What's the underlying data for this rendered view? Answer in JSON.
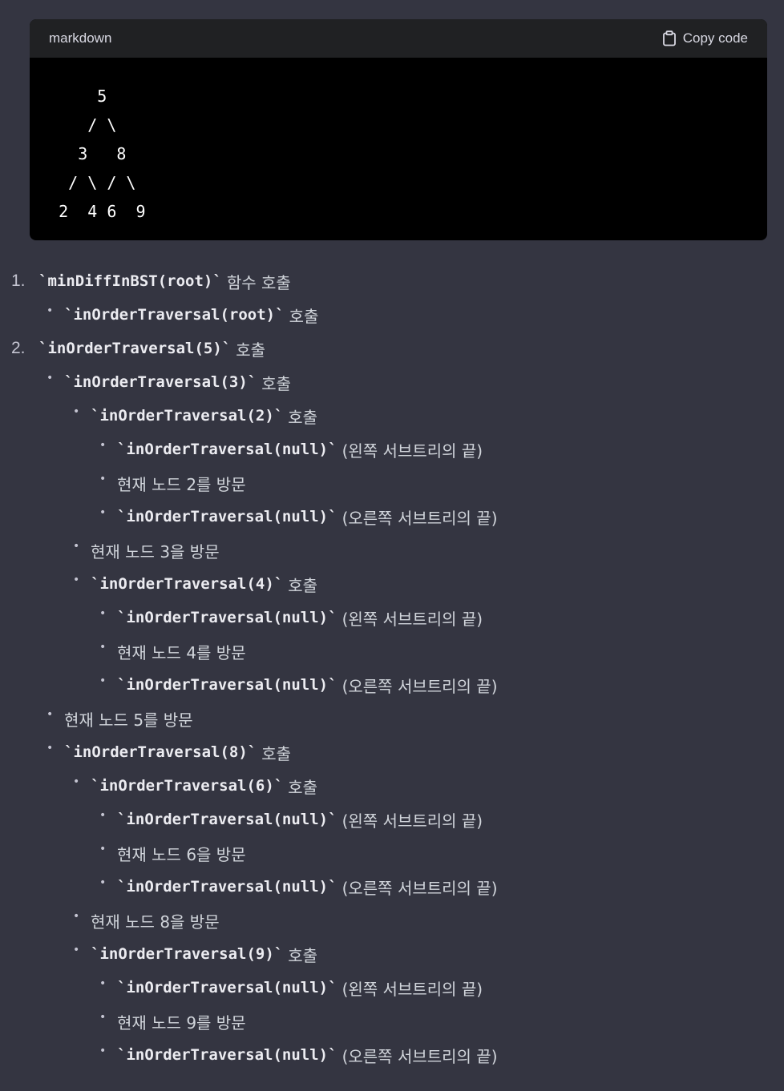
{
  "code_block": {
    "language": "markdown",
    "copy_label": "Copy code",
    "code": "       5\n      / \\\n     3   8\n    / \\ / \\\n   2  4 6  9"
  },
  "items": [
    {
      "marker": "1.",
      "code": "minDiffInBST(root)",
      "text": "함수 호출"
    },
    {
      "marker": "•",
      "code": "inOrderTraversal(root)",
      "text": "호출"
    },
    {
      "marker": "2.",
      "code": "inOrderTraversal(5)",
      "text": "호출"
    },
    {
      "marker": "•",
      "code": "inOrderTraversal(3)",
      "text": "호출"
    },
    {
      "marker": "•",
      "code": "inOrderTraversal(2)",
      "text": "호출"
    },
    {
      "marker": "•",
      "code": "inOrderTraversal(null)",
      "text": "(왼쪽 서브트리의 끝)"
    },
    {
      "marker": "•",
      "code": "",
      "text": "현재 노드 2를 방문"
    },
    {
      "marker": "•",
      "code": "inOrderTraversal(null)",
      "text": "(오른쪽 서브트리의 끝)"
    },
    {
      "marker": "•",
      "code": "",
      "text": "현재 노드 3을 방문"
    },
    {
      "marker": "•",
      "code": "inOrderTraversal(4)",
      "text": "호출"
    },
    {
      "marker": "•",
      "code": "inOrderTraversal(null)",
      "text": "(왼쪽 서브트리의 끝)"
    },
    {
      "marker": "•",
      "code": "",
      "text": "현재 노드 4를 방문"
    },
    {
      "marker": "•",
      "code": "inOrderTraversal(null)",
      "text": "(오른쪽 서브트리의 끝)"
    },
    {
      "marker": "•",
      "code": "",
      "text": "현재 노드 5를 방문"
    },
    {
      "marker": "•",
      "code": "inOrderTraversal(8)",
      "text": "호출"
    },
    {
      "marker": "•",
      "code": "inOrderTraversal(6)",
      "text": "호출"
    },
    {
      "marker": "•",
      "code": "inOrderTraversal(null)",
      "text": "(왼쪽 서브트리의 끝)"
    },
    {
      "marker": "•",
      "code": "",
      "text": "현재 노드 6을 방문"
    },
    {
      "marker": "•",
      "code": "inOrderTraversal(null)",
      "text": "(오른쪽 서브트리의 끝)"
    },
    {
      "marker": "•",
      "code": "",
      "text": "현재 노드 8을 방문"
    },
    {
      "marker": "•",
      "code": "inOrderTraversal(9)",
      "text": "호출"
    },
    {
      "marker": "•",
      "code": "inOrderTraversal(null)",
      "text": "(왼쪽 서브트리의 끝)"
    },
    {
      "marker": "•",
      "code": "",
      "text": "현재 노드 9를 방문"
    },
    {
      "marker": "•",
      "code": "inOrderTraversal(null)",
      "text": "(오른쪽 서브트리의 끝)"
    }
  ]
}
